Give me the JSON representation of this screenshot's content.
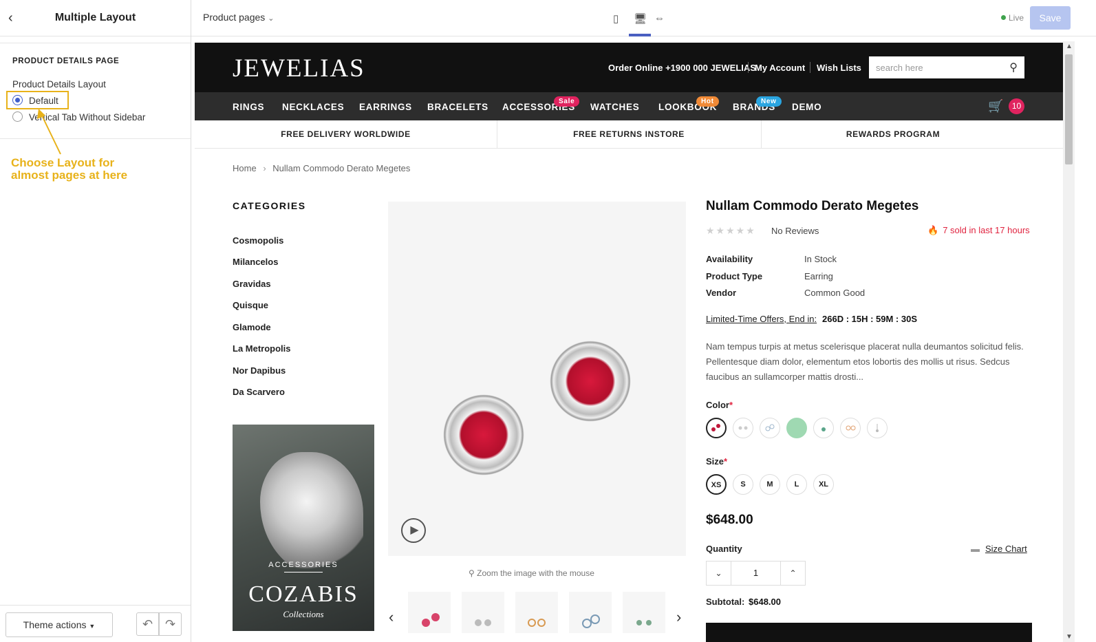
{
  "editor": {
    "panel_title": "Multiple Layout",
    "section_heading": "PRODUCT DETAILS PAGE",
    "field_label": "Product Details Layout",
    "options": [
      {
        "label": "Default",
        "selected": true
      },
      {
        "label": "Vertical Tab Without Sidebar",
        "selected": false
      }
    ],
    "annotation_line1": "Choose Layout for",
    "annotation_line2": "almost pages at here",
    "theme_actions": "Theme actions"
  },
  "topbar": {
    "page_select": "Product pages",
    "live_label": "Live",
    "save_label": "Save",
    "accent": "#4a5fc1"
  },
  "site": {
    "logo": "JEWELIAS",
    "order_online": "Order Online +1900 000 JEWELIAS",
    "my_account": "My Account",
    "wish_lists": "Wish Lists",
    "search_placeholder": "search here",
    "nav": [
      "RINGS",
      "NECKLACES",
      "EARRINGS",
      "BRACELETS",
      "ACCESSORIES",
      "WATCHES",
      "LOOKBOOK",
      "BRANDS",
      "DEMO"
    ],
    "badges": {
      "sale": "Sale",
      "hot": "Hot",
      "new": "New"
    },
    "cart_count": "10",
    "features": [
      "FREE DELIVERY WORLDWIDE",
      "FREE RETURNS INSTORE",
      "REWARDS PROGRAM"
    ]
  },
  "page": {
    "breadcrumb_home": "Home",
    "breadcrumb_current": "Nullam Commodo Derato Megetes",
    "categories_title": "CATEGORIES",
    "categories": [
      "Cosmopolis",
      "Milancelos",
      "Gravidas",
      "Quisque",
      "Glamode",
      "La Metropolis",
      "Nor Dapibus",
      "Da Scarvero"
    ],
    "banner_small": "ACCESSORIES",
    "banner_big": "COZABIS",
    "banner_sub": "Collections",
    "zoom_hint": "Zoom the image with the mouse"
  },
  "product": {
    "title": "Nullam Commodo Derato Megetes",
    "reviews": "No Reviews",
    "rating": 0,
    "sold_note": "7 sold in last 17 hours",
    "availability_label": "Availability",
    "availability": "In Stock",
    "type_label": "Product Type",
    "type": "Earring",
    "vendor_label": "Vendor",
    "vendor": "Common Good",
    "offer_label": "Limited-Time Offers, End in:",
    "countdown": "266D : 15H : 59M : 30S",
    "description": "Nam tempus turpis at metus scelerisque placerat nulla deumantos solicitud felis. Pellentesque diam dolor, elementum etos lobortis des mollis ut risus. Sedcus faucibus an sullamcorper mattis drosti...",
    "color_label": "Color",
    "size_label": "Size",
    "sizes": [
      "XS",
      "S",
      "M",
      "L",
      "XL"
    ],
    "price": "$648.00",
    "quantity_label": "Quantity",
    "size_chart": "Size Chart",
    "quantity": "1",
    "subtotal_label": "Subtotal:",
    "subtotal": "$648.00"
  }
}
